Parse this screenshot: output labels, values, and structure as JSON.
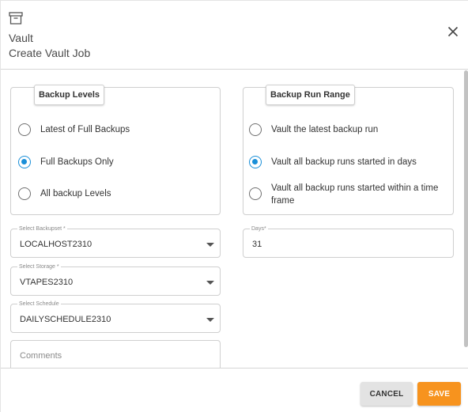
{
  "header": {
    "icon": "archive-box-icon",
    "title": "Vault",
    "subtitle": "Create Vault Job",
    "close_icon": "close-icon"
  },
  "backup_levels": {
    "legend": "Backup Levels",
    "options": [
      {
        "label": "Latest of Full Backups",
        "checked": false
      },
      {
        "label": "Full Backups Only",
        "checked": true
      },
      {
        "label": "All backup Levels",
        "checked": false
      }
    ]
  },
  "backup_run_range": {
    "legend": "Backup Run Range",
    "options": [
      {
        "label": "Vault the latest backup run",
        "checked": false
      },
      {
        "label": "Vault all backup runs started in days",
        "checked": true
      },
      {
        "label": "Vault all backup runs started within a time frame",
        "checked": false
      }
    ]
  },
  "fields": {
    "backupset": {
      "label": "Select Backupset *",
      "value": "LOCALHOST2310"
    },
    "storage": {
      "label": "Select Storage *",
      "value": "VTAPES2310"
    },
    "schedule": {
      "label": "Select Schedule",
      "value": "DAILYSCHEDULE2310"
    },
    "comments": {
      "placeholder": "Comments"
    },
    "days": {
      "label": "Days*",
      "value": "31"
    }
  },
  "footer": {
    "cancel_label": "CANCEL",
    "save_label": "SAVE"
  },
  "colors": {
    "accent": "#1a8fd8",
    "save_button": "#f7931e",
    "cancel_button": "#e3e3e3"
  }
}
